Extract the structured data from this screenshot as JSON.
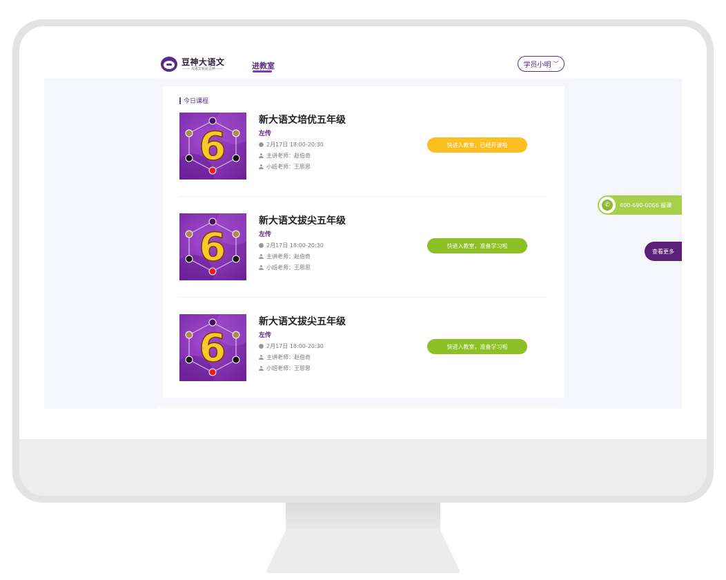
{
  "brand": {
    "name": "豆神大语文",
    "tagline": "—— 大语文就是豆神 ——"
  },
  "nav": {
    "link": "进教室"
  },
  "user": {
    "name": "学员小明",
    "chevron": "﹀"
  },
  "section": {
    "title": "今日课程"
  },
  "courses": [
    {
      "title": "新大语文培优五年级",
      "subtitle": "左传",
      "time": "2月17日  18:00-20:30",
      "teacher": "主讲老师：赵伯奇",
      "assistant": "小班老师：王思思",
      "button": "快进入教室，已经开课啦",
      "button_color": "#fbbf22",
      "grade_number": "6"
    },
    {
      "title": "新大语文拔尖五年级",
      "subtitle": "左传",
      "time": "2月17日  18:00-20:30",
      "teacher": "主讲老师：赵伯奇",
      "assistant": "小班老师：王思思",
      "button": "快进入教室，准备学习啦",
      "button_color": "#8cc025",
      "grade_number": "6"
    },
    {
      "title": "新大语文拔尖五年级",
      "subtitle": "左传",
      "time": "2月17日  18:00-20:30",
      "teacher": "主讲老师：赵伯奇",
      "assistant": "小班老师：王思思",
      "button": "快进入教室，准备学习啦",
      "button_color": "#8cc025",
      "grade_number": "6"
    }
  ],
  "hotline": {
    "text": "400-690-0066  报课"
  },
  "more": {
    "label": "查看更多"
  },
  "icons": {
    "clock": "clock-icon",
    "person": "person-icon",
    "phone": "phone-icon",
    "chevron": "chevron-down-icon"
  }
}
